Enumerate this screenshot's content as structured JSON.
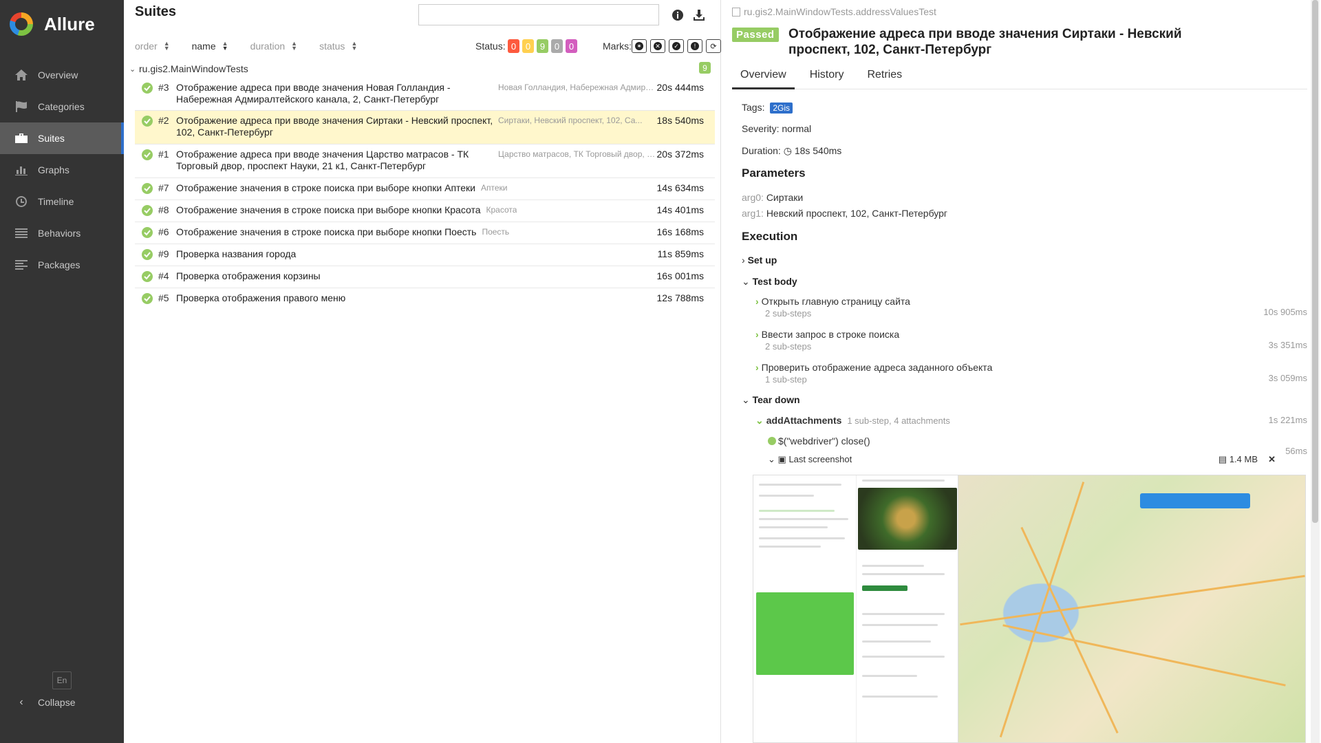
{
  "app": {
    "name": "Allure"
  },
  "sidebar": {
    "items": [
      {
        "label": "Overview",
        "icon": "home-icon"
      },
      {
        "label": "Categories",
        "icon": "flag-icon"
      },
      {
        "label": "Suites",
        "icon": "briefcase-icon"
      },
      {
        "label": "Graphs",
        "icon": "bar-chart-icon"
      },
      {
        "label": "Timeline",
        "icon": "clock-icon"
      },
      {
        "label": "Behaviors",
        "icon": "list-icon"
      },
      {
        "label": "Packages",
        "icon": "align-left-icon"
      }
    ],
    "active": "Suites",
    "lang": "En",
    "collapse": "Collapse"
  },
  "suites": {
    "title": "Suites",
    "search_value": "",
    "sort": {
      "order": "order",
      "name": "name",
      "duration": "duration",
      "status": "status"
    },
    "status_label": "Status:",
    "status_counts": [
      {
        "value": "0",
        "color": "#fd5a3e"
      },
      {
        "value": "0",
        "color": "#ffd050"
      },
      {
        "value": "9",
        "color": "#97cc64"
      },
      {
        "value": "0",
        "color": "#aaaaaa"
      },
      {
        "value": "0",
        "color": "#d35ebe"
      }
    ],
    "marks_label": "Marks:",
    "group": {
      "name": "ru.gis2.MainWindowTests",
      "count": "9"
    },
    "rows": [
      {
        "num": "#3",
        "title": "Отображение адреса при вводе значения Новая Голландия - Набережная Адмиралтейского канала, 2, Санкт-Петербург",
        "param": "Новая Голландия, Набережная Адмирал...",
        "duration": "20s 444ms"
      },
      {
        "num": "#2",
        "title": "Отображение адреса при вводе значения Сиртаки - Невский проспект, 102, Санкт-Петербург",
        "param": "Сиртаки, Невский проспект, 102, Са...",
        "duration": "18s 540ms"
      },
      {
        "num": "#1",
        "title": "Отображение адреса при вводе значения Царство матрасов - ТК Торговый двор, проспект Науки, 21 к1, Санкт-Петербург",
        "param": "Царство матрасов, ТК Торговый двор, пр...",
        "duration": "20s 372ms"
      },
      {
        "num": "#7",
        "title": "Отображение значения в строке поиска при выборе кнопки Аптеки",
        "param": "Аптеки",
        "duration": "14s 634ms"
      },
      {
        "num": "#8",
        "title": "Отображение значения в строке поиска при выборе кнопки Красота",
        "param": "Красота",
        "duration": "14s 401ms"
      },
      {
        "num": "#6",
        "title": "Отображение значения в строке поиска при выборе кнопки Поесть",
        "param": "Поесть",
        "duration": "16s 168ms"
      },
      {
        "num": "#9",
        "title": "Проверка названия города",
        "param": "",
        "duration": "11s 859ms"
      },
      {
        "num": "#4",
        "title": "Проверка отображения корзины",
        "param": "",
        "duration": "16s 001ms"
      },
      {
        "num": "#5",
        "title": "Проверка отображения правого меню",
        "param": "",
        "duration": "12s 788ms"
      }
    ]
  },
  "detail": {
    "breadcrumb": "ru.gis2.MainWindowTests.addressValuesTest",
    "status": "Passed",
    "title": "Отображение адреса при вводе значения Сиртаки - Невский проспект, 102, Санкт-Петербург",
    "tabs": [
      "Overview",
      "History",
      "Retries"
    ],
    "tags_label": "Tags:",
    "tag": "2Gis",
    "severity": "Severity: normal",
    "duration_label": "Duration:",
    "duration": "18s 540ms",
    "parameters_title": "Parameters",
    "params": [
      {
        "key": "arg0:",
        "value": "Сиртаки"
      },
      {
        "key": "arg1:",
        "value": "Невский проспект, 102, Санкт-Петербург"
      }
    ],
    "execution_title": "Execution",
    "setup": "Set up",
    "test_body": "Test body",
    "steps": [
      {
        "name": "Открыть главную страницу сайта",
        "sub": "2 sub-steps",
        "duration": "10s 905ms"
      },
      {
        "name": "Ввести запрос в строке поиска",
        "sub": "2 sub-steps",
        "duration": "3s 351ms"
      },
      {
        "name": "Проверить отображение адреса заданного объекта",
        "sub": "1 sub-step",
        "duration": "3s 059ms"
      }
    ],
    "teardown": "Tear down",
    "attach_step": "addAttachments",
    "attach_meta": "1 sub-step, 4 attachments",
    "attach_duration": "1s 221ms",
    "close_step": "$(\"webdriver\") close()",
    "close_duration": "56ms",
    "screenshot_label": "Last screenshot",
    "screenshot_size": "1.4 MB"
  }
}
